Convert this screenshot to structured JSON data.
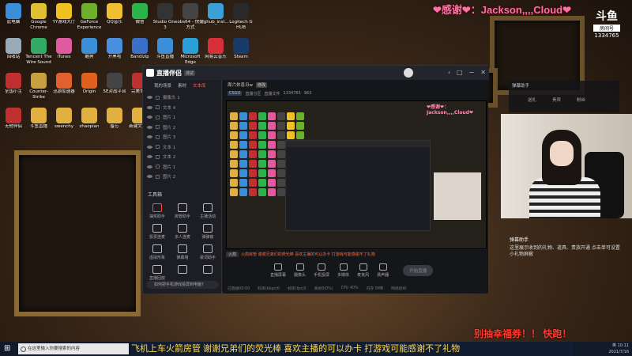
{
  "overlay": {
    "thanks_top": "❤感谢❤：Jackson,,,,Cloud❤",
    "platform_logo": "斗鱼",
    "room_label": "房间号",
    "room_number": "1334765",
    "lottery": "别抽幸福券！！ 快跑！",
    "marquee": "飞机上车火箭房管 谢谢兄弟们的荧光棒 喜欢主播的可以办卡 打游戏可能感谢不了礼物"
  },
  "desktop_icons": [
    {
      "label": "此电脑",
      "color": "#3a8fd8"
    },
    {
      "label": "Google Chrome",
      "color": "#e0c030"
    },
    {
      "label": "YY游戏大厅",
      "color": "#f0c020"
    },
    {
      "label": "GeForce Experience",
      "color": "#6cb02c"
    },
    {
      "label": "QQ音乐",
      "color": "#f0c030"
    },
    {
      "label": "微信",
      "color": "#2cb44a"
    },
    {
      "label": "Studio One 3",
      "color": "#333"
    },
    {
      "label": "obs64 - 快捷方式",
      "color": "#444"
    },
    {
      "label": "lghub_inst...",
      "color": "#3aa0d8"
    },
    {
      "label": "Logitech G HUB",
      "color": "#2a2a2a"
    },
    {
      "label": "回收站",
      "color": "#9ab"
    },
    {
      "label": "Tencent The Wire Sound",
      "color": "#3a6"
    },
    {
      "label": "iTunes",
      "color": "#e05aa0"
    },
    {
      "label": "酷狗",
      "color": "#3a8fd8"
    },
    {
      "label": "开黑啦",
      "color": "#4a90e0"
    },
    {
      "label": "Bandizip",
      "color": "#3a70c8"
    },
    {
      "label": "斗鱼直播",
      "color": "#3a8fd8"
    },
    {
      "label": "Microsoft Edge",
      "color": "#2a9fd8"
    },
    {
      "label": "网易云音乐",
      "color": "#d8303a"
    },
    {
      "label": "Steam",
      "color": "#1a3a6a"
    },
    {
      "label": "全国小主",
      "color": "#c03030"
    },
    {
      "label": "Counter-Strike Global Off...",
      "color": "#c8a040"
    },
    {
      "label": "迅游加速器",
      "color": "#e06030"
    },
    {
      "label": "Origin",
      "color": "#e06020"
    },
    {
      "label": "5E对战平台",
      "color": "#444"
    },
    {
      "label": "完美世界",
      "color": "#c03030"
    },
    {
      "label": "CSGO工具箱 1.0.8",
      "color": "#c03030"
    },
    {
      "label": "game",
      "color": "#e0b040"
    },
    {
      "label": "腾讯QQ",
      "color": "#3a8fd8"
    },
    {
      "label": "网易云游戏",
      "color": "#d83030"
    },
    {
      "label": "无他伴侣",
      "color": "#c03030"
    },
    {
      "label": "斗鱼直播",
      "color": "#e0b040"
    },
    {
      "label": "swenchy",
      "color": "#e0b040"
    },
    {
      "label": "zhaopian",
      "color": "#e0b040"
    },
    {
      "label": "备忘",
      "color": "#e0b040"
    },
    {
      "label": "新建文件夹",
      "color": "#e0b040"
    },
    {
      "label": "新建文件夹",
      "color": "#e0b040"
    },
    {
      "label": "新建文件夹",
      "color": "#e0b040"
    },
    {
      "label": "小坦克Demo",
      "color": "#c03030"
    }
  ],
  "app": {
    "title": "直播伴侣",
    "title_tag": "测试",
    "window_controls": [
      "‹",
      "□",
      "−",
      "✕"
    ],
    "left_tabs": [
      "我的场景",
      "素材",
      "文本库"
    ],
    "scenes": [
      "摄像头 1",
      "文本 4",
      "图片 1",
      "图片 2",
      "图片 3",
      "文本 1",
      "文本 2",
      "图片 1",
      "图片 2"
    ],
    "tools_title": "工具箱",
    "tools": [
      {
        "label": "抽奖助手",
        "red": true
      },
      {
        "label": "房管助手",
        "red": false
      },
      {
        "label": "主播活动",
        "red": false
      },
      {
        "label": "投票连麦",
        "red": false
      },
      {
        "label": "多人连麦",
        "red": false
      },
      {
        "label": "弹弹窗",
        "red": false
      },
      {
        "label": "虚拟形象",
        "red": false
      },
      {
        "label": "弹幕墙",
        "red": false
      },
      {
        "label": "歌词助手",
        "red": false
      },
      {
        "label": "直播回放",
        "red": false
      },
      {
        "label": "",
        "red": false
      },
      {
        "label": "",
        "red": false
      }
    ],
    "notice": "如何把手机游戏投屏到电脑?",
    "channel_title": "周六休息日w",
    "channel_badge": "修改",
    "channel_tag": "CSGO",
    "channel_info": [
      "直播分区",
      "直播文件",
      "1334765",
      "963"
    ],
    "preview_thanks": "❤感谢❤：Jackson,,,,Cloud❤",
    "fire_chip": "火箭",
    "fire_text": "火箭房管 谢谢兄弟们的荧光棒 喜欢主播的可以办卡 打游戏可能感谢不了礼物",
    "control_tools": [
      "直播屏幕",
      "摄像头",
      "手机投屏",
      "多媒体",
      "麦克风",
      "扬声器"
    ],
    "start_live": "开始直播",
    "status": [
      "已直播00:00",
      "码率(kbps)0",
      "帧率(fps)0",
      "丢帧0(0%)",
      "CPU 40%",
      "内存 0MB",
      "网络良好"
    ]
  },
  "chat_panel": {
    "title": "弹幕助手",
    "tabs": [
      "送礼",
      "贵宾",
      "粉丝"
    ]
  },
  "helper": {
    "title": "弹幕助手",
    "text": "这里展示收到的礼物、道具、贵族开通 点击单可设置小礼物屏蔽"
  },
  "taskbar": {
    "start": "⊞",
    "search_placeholder": "在这里输入你要搜索的内容",
    "tray_time": "10:11",
    "tray_date": "2021/7/16",
    "tray_lang": "英"
  }
}
